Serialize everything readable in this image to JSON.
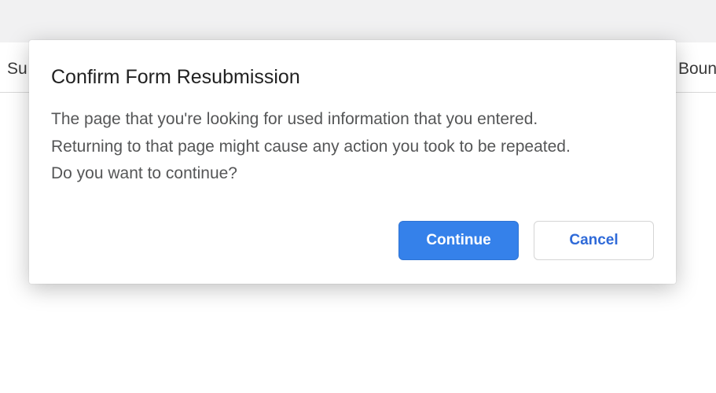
{
  "background": {
    "left_fragment": "Su",
    "right_fragment": "Boun"
  },
  "dialog": {
    "title": "Confirm Form Resubmission",
    "body": "The page that you're looking for used information that you entered.\nReturning to that page might cause any action you took to be repeated.\nDo you want to continue?",
    "buttons": {
      "continue": "Continue",
      "cancel": "Cancel"
    }
  }
}
